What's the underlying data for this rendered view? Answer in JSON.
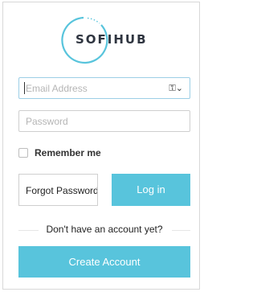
{
  "brand": {
    "name": "SOFIHUB",
    "accent": "#58c4dc"
  },
  "form": {
    "email_placeholder": "Email Address",
    "password_placeholder": "Password",
    "remember_label": "Remember me",
    "remember_checked": false
  },
  "actions": {
    "forgot_label": "Forgot Password",
    "login_label": "Log in",
    "signup_prompt": "Don't have an account yet?",
    "create_label": "Create Account"
  },
  "icons": {
    "password_manager": "key-icon"
  }
}
